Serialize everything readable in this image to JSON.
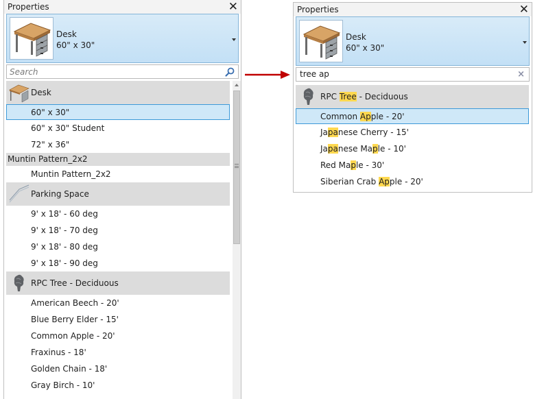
{
  "left": {
    "title": "Properties",
    "close": "✕",
    "selector": {
      "name": "Desk",
      "size": "60\" x 30\""
    },
    "search": {
      "placeholder": "Search",
      "value": ""
    },
    "list": [
      {
        "kind": "group",
        "label": "Desk",
        "icon": "desk-icon"
      },
      {
        "kind": "item",
        "label": "60\" x 30\"",
        "selected": true
      },
      {
        "kind": "item",
        "label": "60\" x 30\" Student"
      },
      {
        "kind": "item",
        "label": "72\" x 36\""
      },
      {
        "kind": "group",
        "label": "Muntin Pattern_2x2",
        "icon": null
      },
      {
        "kind": "item",
        "label": "Muntin Pattern_2x2"
      },
      {
        "kind": "group",
        "label": "Parking Space",
        "icon": "parking-space-icon"
      },
      {
        "kind": "item",
        "label": "9' x 18' - 60 deg"
      },
      {
        "kind": "item",
        "label": "9' x 18' - 70 deg"
      },
      {
        "kind": "item",
        "label": "9' x 18' - 80 deg"
      },
      {
        "kind": "item",
        "label": "9' x 18' - 90 deg"
      },
      {
        "kind": "group",
        "label": "RPC Tree - Deciduous",
        "icon": "tree-icon"
      },
      {
        "kind": "item",
        "label": "American Beech - 20'"
      },
      {
        "kind": "item",
        "label": "Blue Berry Elder - 15'"
      },
      {
        "kind": "item",
        "label": "Common Apple - 20'"
      },
      {
        "kind": "item",
        "label": "Fraxinus - 18'"
      },
      {
        "kind": "item",
        "label": "Golden Chain - 18'"
      },
      {
        "kind": "item",
        "label": "Gray Birch - 10'"
      }
    ]
  },
  "right": {
    "title": "Properties",
    "close": "✕",
    "selector": {
      "name": "Desk",
      "size": "60\" x 30\""
    },
    "search": {
      "value": "tree ap",
      "clear": "×"
    },
    "list": [
      {
        "kind": "group",
        "icon": "tree-icon",
        "parts": [
          [
            "RPC ",
            false
          ],
          [
            "Tree",
            true
          ],
          [
            " - Deciduous",
            false
          ]
        ]
      },
      {
        "kind": "item",
        "selected": true,
        "parts": [
          [
            "Common ",
            false
          ],
          [
            "Ap",
            true
          ],
          [
            "ple - 20'",
            false
          ]
        ]
      },
      {
        "kind": "item",
        "parts": [
          [
            "Ja",
            false
          ],
          [
            "pa",
            true
          ],
          [
            "nese Cherry - 15'",
            false
          ]
        ]
      },
      {
        "kind": "item",
        "parts": [
          [
            "Ja",
            false
          ],
          [
            "pa",
            true
          ],
          [
            "nese Ma",
            false
          ],
          [
            "p",
            true
          ],
          [
            "le - 10'",
            false
          ]
        ]
      },
      {
        "kind": "item",
        "parts": [
          [
            "Red Ma",
            false
          ],
          [
            "p",
            true
          ],
          [
            "le - 30'",
            false
          ]
        ]
      },
      {
        "kind": "item",
        "parts": [
          [
            "Siberian Crab ",
            false
          ],
          [
            "Ap",
            true
          ],
          [
            "ple - 20'",
            false
          ]
        ]
      }
    ]
  },
  "arrow": {
    "color": "#c00000"
  },
  "colors": {
    "selection_fill": "#cfe8f8",
    "selection_border": "#3c99d8",
    "highlight": "#ffd84f",
    "group_header": "#dcdcdc"
  }
}
